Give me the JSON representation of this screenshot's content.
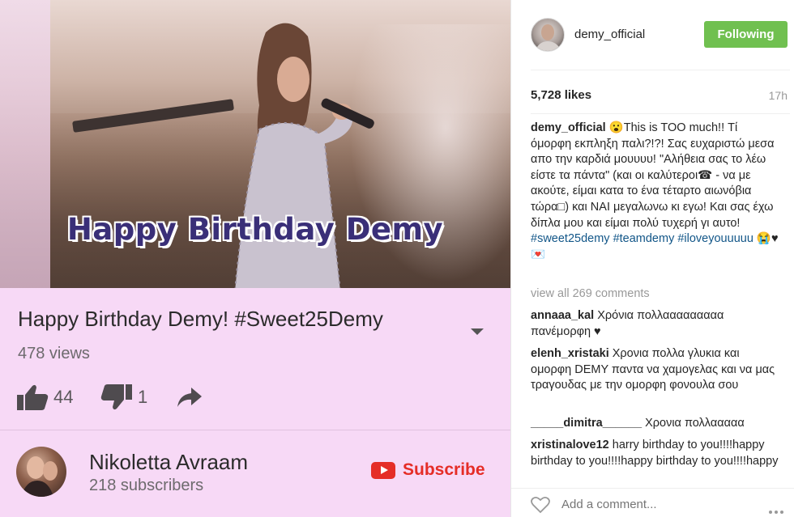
{
  "video": {
    "overlay_caption": "Happy Birthday Demy",
    "title": "Happy Birthday Demy! #Sweet25Demy",
    "views": "478 views",
    "likes": "44",
    "dislikes": "1"
  },
  "channel": {
    "name": "Nikoletta Avraam",
    "subscribers": "218 subscribers",
    "subscribe_label": "Subscribe"
  },
  "instagram": {
    "username": "demy_official",
    "follow_label": "Following",
    "likes": "5,728 likes",
    "time_ago": "17h",
    "caption": {
      "user": "demy_official",
      "text": " 😮This is TOO much!! Τί όμορφη εκπληξη παλι?!?! Σας ευχαριστώ μεσα απο την καρδιά μουυυυ! \"Αλήθεια σας το λέω είστε τα πάντα\" (και οι καλύτεροι☎ - να με ακούτε, είμαι κατα το ένα τέταρτο αιωνόβια τώρα□) και ΝΑΙ μεγαλωνω κι εγω! Και σας έχω δίπλα μου και είμαι πολύ τυχερή γι αυτο! ",
      "tag1": "#sweet25demy",
      "tag2": "#teamdemy",
      "tag3": "#iloveyouuuuu",
      "tail": " 😭♥💌"
    },
    "view_all": "view all 269 comments",
    "comments": [
      {
        "user": "annaaa_kal",
        "text": " Χρόνια πολλααααααααα πανέμορφη ♥"
      },
      {
        "user": "elenh_xristaki",
        "text": " Χρονια πολλα γλυκια και ομορφη DEMY παντα να χαμογελας και να μας τραγουδας με την ομορφη φονουλα σου"
      },
      {
        "user": "_____dimitra______",
        "text": " Χρονια πολλααααα"
      },
      {
        "user": "xristinalove12",
        "text": " harry birthday to you!!!!happy birthday to you!!!!happy birthday to you!!!!happy birthday"
      }
    ],
    "comment_placeholder": "Add a comment..."
  },
  "colors": {
    "left_bg": "#f7d9f6",
    "follow_green": "#70c050",
    "youtube_red": "#e52d27",
    "hashtag_blue": "#125688"
  },
  "icons": [
    "thumbs-up-icon",
    "thumbs-down-icon",
    "share-icon",
    "chevron-down-icon",
    "youtube-logo-icon",
    "heart-icon",
    "more-icon"
  ]
}
